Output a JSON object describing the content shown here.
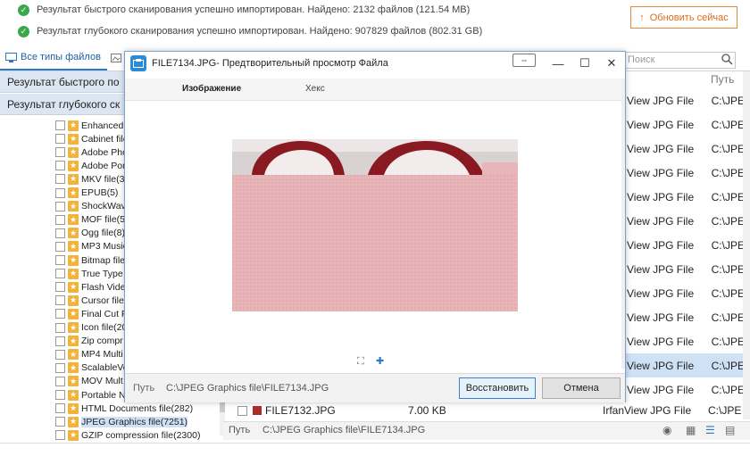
{
  "status": {
    "quick_scan": "Результат быстрого сканирования успешно импортирован. Найдено: 2132 файлов (121.54 MB)",
    "deep_scan": "Результат глубокого сканирования успешно импортирован. Найдено: 907829 файлов (802.31 GB)",
    "update_button": "Обновить сейчас"
  },
  "tabs": {
    "all_types": "Все типы файлов",
    "search_placeholder": "Поиск"
  },
  "sections": {
    "quick": "Результат быстрого по",
    "deep": "Результат глубокого ск"
  },
  "tree": [
    {
      "label": "Enhanced",
      "selected": false
    },
    {
      "label": "Cabinet file",
      "selected": false
    },
    {
      "label": "Adobe Pho",
      "selected": false
    },
    {
      "label": "Adobe Por",
      "selected": false
    },
    {
      "label": "MKV file(3)",
      "selected": false
    },
    {
      "label": "EPUB(5)",
      "selected": false
    },
    {
      "label": "ShockWav",
      "selected": false
    },
    {
      "label": "MOF file(5",
      "selected": false
    },
    {
      "label": "Ogg file(8)",
      "selected": false
    },
    {
      "label": "MP3 Music",
      "selected": false
    },
    {
      "label": "Bitmap file",
      "selected": false
    },
    {
      "label": "True Type",
      "selected": false
    },
    {
      "label": "Flash Vide",
      "selected": false
    },
    {
      "label": "Cursor file",
      "selected": false
    },
    {
      "label": "Final Cut P",
      "selected": false
    },
    {
      "label": "Icon file(20",
      "selected": false
    },
    {
      "label": "Zip compr",
      "selected": false
    },
    {
      "label": "MP4 Multi",
      "selected": false
    },
    {
      "label": "ScalableVe",
      "selected": false
    },
    {
      "label": "MOV Mult",
      "selected": false
    },
    {
      "label": "Portable N",
      "selected": false
    },
    {
      "label": "HTML Documents file(282)",
      "selected": false
    },
    {
      "label": "JPEG Graphics file(7251)",
      "selected": true
    },
    {
      "label": "GZIP compression file(2300)",
      "selected": false
    }
  ],
  "right_column": {
    "header": "Путь",
    "rows": [
      {
        "type": "View JPG File",
        "path": "C:\\JPE",
        "selected": false
      },
      {
        "type": "View JPG File",
        "path": "C:\\JPE",
        "selected": false
      },
      {
        "type": "View JPG File",
        "path": "C:\\JPE",
        "selected": false
      },
      {
        "type": "View JPG File",
        "path": "C:\\JPE",
        "selected": false
      },
      {
        "type": "View JPG File",
        "path": "C:\\JPE",
        "selected": false
      },
      {
        "type": "View JPG File",
        "path": "C:\\JPE",
        "selected": false
      },
      {
        "type": "View JPG File",
        "path": "C:\\JPE",
        "selected": false
      },
      {
        "type": "View JPG File",
        "path": "C:\\JPE",
        "selected": false
      },
      {
        "type": "View JPG File",
        "path": "C:\\JPE",
        "selected": false
      },
      {
        "type": "View JPG File",
        "path": "C:\\JPE",
        "selected": false
      },
      {
        "type": "View JPG File",
        "path": "C:\\JPE",
        "selected": false
      },
      {
        "type": "View JPG File",
        "path": "C:\\JPE",
        "selected": true
      },
      {
        "type": "View JPG File",
        "path": "C:\\JPE",
        "selected": false
      }
    ]
  },
  "partial_row": {
    "name": "FILE7132.JPG",
    "size": "7.00 KB",
    "type": "IrfanView JPG File",
    "path": "C:\\JPE"
  },
  "path_bar": {
    "label": "Путь",
    "value": "C:\\JPEG Graphics file\\FILE7134.JPG"
  },
  "dialog": {
    "title": "FILE7134.JPG- Предтворительный просмотр Файла",
    "tab_image": "Изображение",
    "tab_hex": "Хекс",
    "path_label": "Путь",
    "path_value": "C:\\JPEG Graphics file\\FILE7134.JPG",
    "restore_button": "Восстановить",
    "cancel_button": "Отмена"
  },
  "colors": {
    "accent": "#2b78c5",
    "update_orange": "#e16c1c",
    "selected_row": "#cfe1f5",
    "section_bg": "#dbe6f2",
    "photo_pink": "#e7b0b4"
  }
}
